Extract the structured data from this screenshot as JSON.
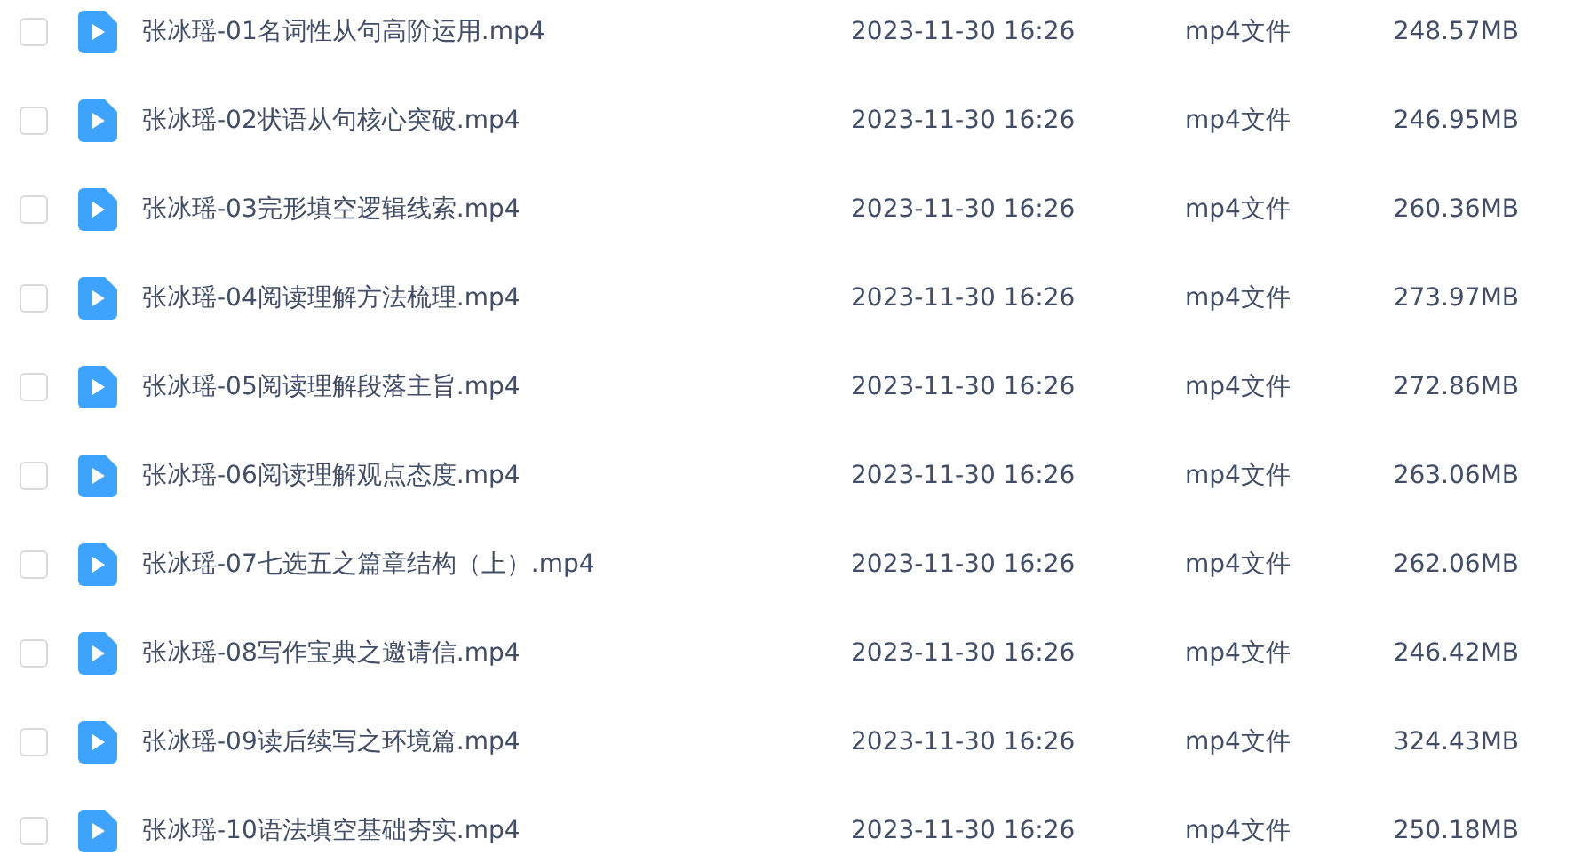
{
  "files": [
    {
      "name": "张冰瑶-01名词性从句高阶运用.mp4",
      "date": "2023-11-30 16:26",
      "type": "mp4文件",
      "size": "248.57MB",
      "selected": false
    },
    {
      "name": "张冰瑶-02状语从句核心突破.mp4",
      "date": "2023-11-30 16:26",
      "type": "mp4文件",
      "size": "246.95MB",
      "selected": false
    },
    {
      "name": "张冰瑶-03完形填空逻辑线索.mp4",
      "date": "2023-11-30 16:26",
      "type": "mp4文件",
      "size": "260.36MB",
      "selected": false
    },
    {
      "name": "张冰瑶-04阅读理解方法梳理.mp4",
      "date": "2023-11-30 16:26",
      "type": "mp4文件",
      "size": "273.97MB",
      "selected": false
    },
    {
      "name": "张冰瑶-05阅读理解段落主旨.mp4",
      "date": "2023-11-30 16:26",
      "type": "mp4文件",
      "size": "272.86MB",
      "selected": false
    },
    {
      "name": "张冰瑶-06阅读理解观点态度.mp4",
      "date": "2023-11-30 16:26",
      "type": "mp4文件",
      "size": "263.06MB",
      "selected": false
    },
    {
      "name": "张冰瑶-07七选五之篇章结构（上）.mp4",
      "date": "2023-11-30 16:26",
      "type": "mp4文件",
      "size": "262.06MB",
      "selected": false
    },
    {
      "name": "张冰瑶-08写作宝典之邀请信.mp4",
      "date": "2023-11-30 16:26",
      "type": "mp4文件",
      "size": "246.42MB",
      "selected": false
    },
    {
      "name": "张冰瑶-09读后续写之环境篇.mp4",
      "date": "2023-11-30 16:26",
      "type": "mp4文件",
      "size": "324.43MB",
      "selected": false
    },
    {
      "name": "张冰瑶-10语法填空基础夯实.mp4",
      "date": "2023-11-30 16:26",
      "type": "mp4文件",
      "size": "250.18MB",
      "selected": false
    }
  ]
}
